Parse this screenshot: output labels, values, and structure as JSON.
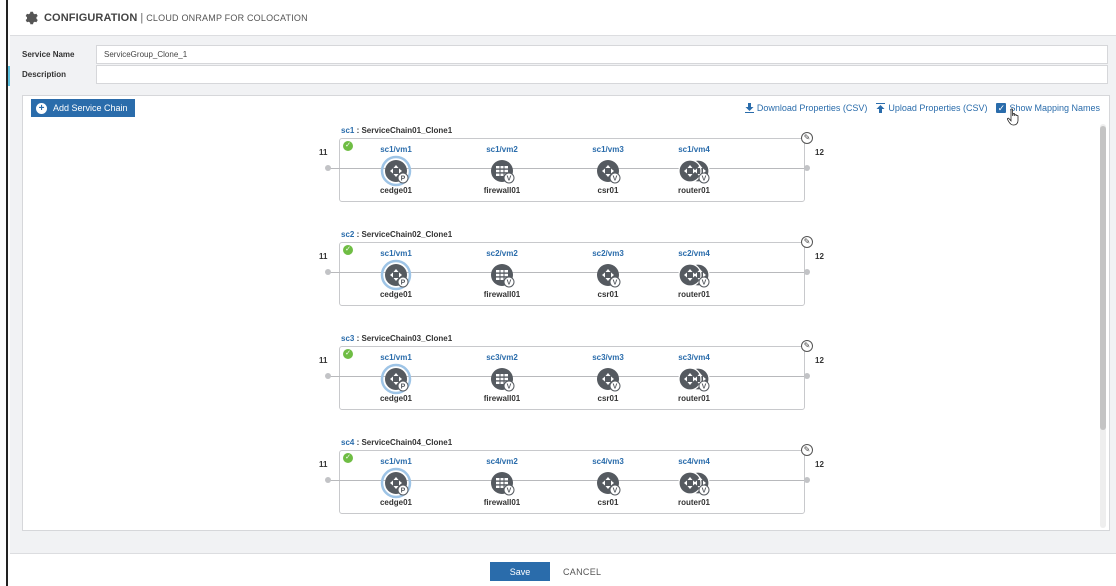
{
  "header": {
    "title": "CONFIGURATION",
    "separator": "|",
    "subtitle": "CLOUD ONRAMP FOR COLOCATION",
    "icon": "gear-icon"
  },
  "form": {
    "service_name_label": "Service Name",
    "service_name_value": "ServiceGroup_Clone_1",
    "description_label": "Description",
    "description_value": ""
  },
  "toolbar": {
    "add_label": "Add Service Chain",
    "download_label": "Download Properties (CSV)",
    "upload_label": "Upload Properties (CSV)",
    "show_mapping_label": "Show Mapping Names",
    "show_mapping_checked": true
  },
  "chains": [
    {
      "id": "sc1",
      "name": "ServiceChain01_Clone1",
      "in_port": "11",
      "out_port": "12",
      "status": "ok",
      "vms": [
        {
          "label": "sc1/vm1",
          "name": "cedge01",
          "icon": "router-icon",
          "badge": "P",
          "selected": true
        },
        {
          "label": "sc1/vm2",
          "name": "firewall01",
          "icon": "firewall-icon",
          "badge": "V",
          "selected": false
        },
        {
          "label": "sc1/vm3",
          "name": "csr01",
          "icon": "router-icon",
          "badge": "V",
          "selected": false
        },
        {
          "label": "sc1/vm4",
          "name": "router01",
          "icon": "router-stack-icon",
          "badge": "V",
          "selected": false
        }
      ]
    },
    {
      "id": "sc2",
      "name": "ServiceChain02_Clone1",
      "in_port": "11",
      "out_port": "12",
      "status": "ok",
      "vms": [
        {
          "label": "sc1/vm1",
          "name": "cedge01",
          "icon": "router-icon",
          "badge": "P",
          "selected": true
        },
        {
          "label": "sc2/vm2",
          "name": "firewall01",
          "icon": "firewall-icon",
          "badge": "V",
          "selected": false
        },
        {
          "label": "sc2/vm3",
          "name": "csr01",
          "icon": "router-icon",
          "badge": "V",
          "selected": false
        },
        {
          "label": "sc2/vm4",
          "name": "router01",
          "icon": "router-stack-icon",
          "badge": "V",
          "selected": false
        }
      ]
    },
    {
      "id": "sc3",
      "name": "ServiceChain03_Clone1",
      "in_port": "11",
      "out_port": "12",
      "status": "ok",
      "vms": [
        {
          "label": "sc1/vm1",
          "name": "cedge01",
          "icon": "router-icon",
          "badge": "P",
          "selected": true
        },
        {
          "label": "sc3/vm2",
          "name": "firewall01",
          "icon": "firewall-icon",
          "badge": "V",
          "selected": false
        },
        {
          "label": "sc3/vm3",
          "name": "csr01",
          "icon": "router-icon",
          "badge": "V",
          "selected": false
        },
        {
          "label": "sc3/vm4",
          "name": "router01",
          "icon": "router-stack-icon",
          "badge": "V",
          "selected": false
        }
      ]
    },
    {
      "id": "sc4",
      "name": "ServiceChain04_Clone1",
      "in_port": "11",
      "out_port": "12",
      "status": "ok",
      "vms": [
        {
          "label": "sc1/vm1",
          "name": "cedge01",
          "icon": "router-icon",
          "badge": "P",
          "selected": true
        },
        {
          "label": "sc4/vm2",
          "name": "firewall01",
          "icon": "firewall-icon",
          "badge": "V",
          "selected": false
        },
        {
          "label": "sc4/vm3",
          "name": "csr01",
          "icon": "router-icon",
          "badge": "V",
          "selected": false
        },
        {
          "label": "sc4/vm4",
          "name": "router01",
          "icon": "router-stack-icon",
          "badge": "V",
          "selected": false
        }
      ]
    }
  ],
  "footer": {
    "save_label": "Save",
    "cancel_label": "CANCEL"
  },
  "colors": {
    "accent": "#2a6cab",
    "ok": "#6fbd44",
    "device": "#555a60"
  }
}
